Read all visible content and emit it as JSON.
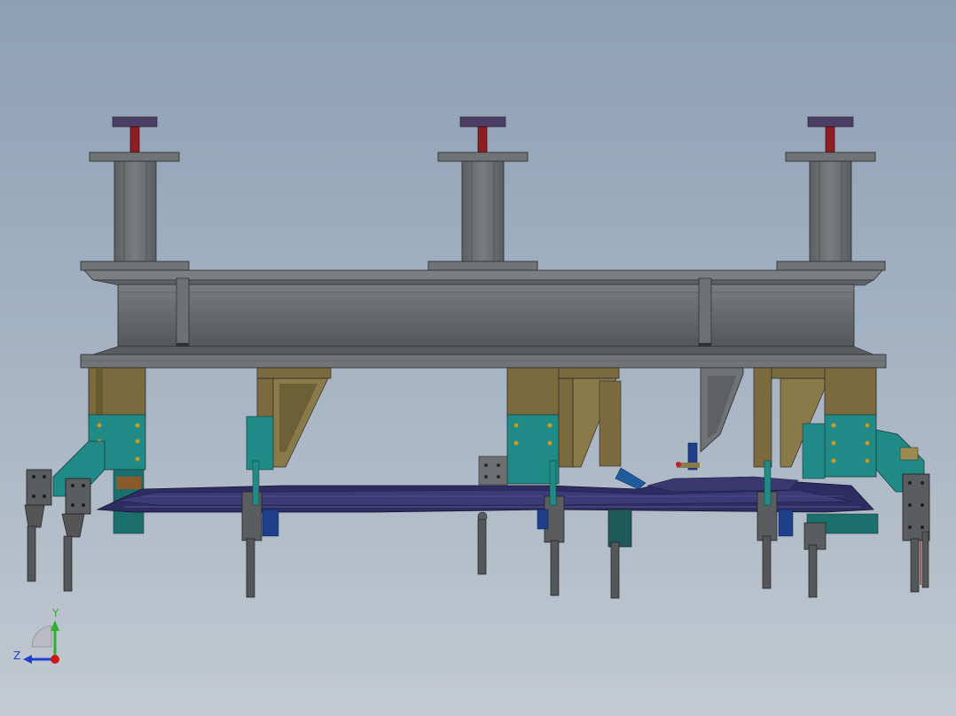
{
  "viewport": {
    "background_top": "#8d9fb5",
    "background_bottom": "#c2c9d1"
  },
  "triad": {
    "y_label": "Y",
    "z_label": "Z",
    "y_color": "#2fae2f",
    "z_color": "#1f3fd0",
    "x_color": "#d01818"
  },
  "colors": {
    "frame_grey": "#6d7073",
    "frame_dark": "#4f5255",
    "pad_purple": "#4c3d66",
    "pin_red": "#8f1d24",
    "bracket_olive": "#7a6a3e",
    "clamp_teal": "#1f8a86",
    "part_navy": "#2f2c63",
    "rod_grey": "#54575a"
  }
}
